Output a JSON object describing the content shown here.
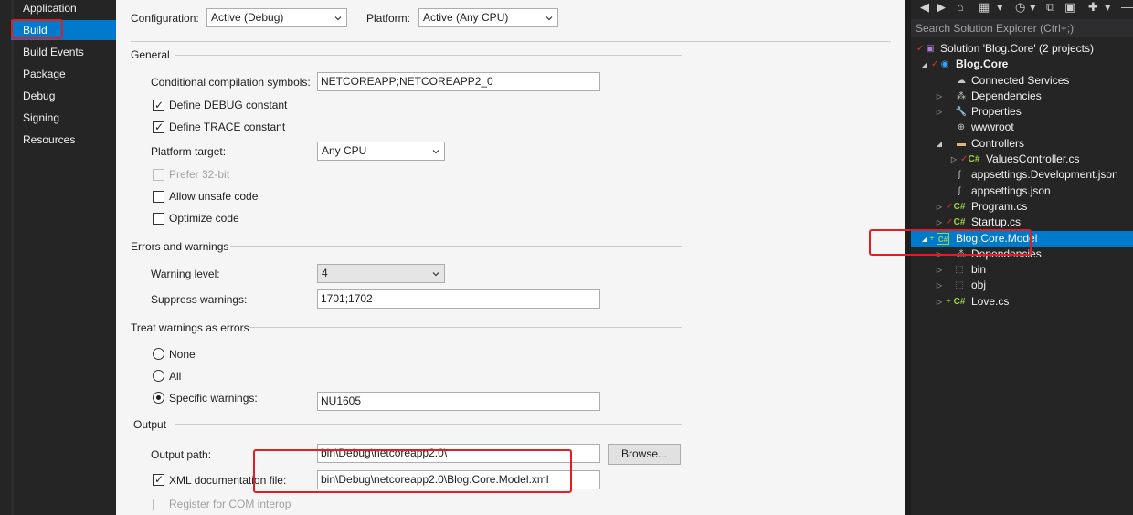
{
  "nav": {
    "items": [
      "Application",
      "Build",
      "Build Events",
      "Package",
      "Debug",
      "Signing",
      "Resources"
    ],
    "active": "Build"
  },
  "header": {
    "configuration_label": "Configuration:",
    "configuration_value": "Active (Debug)",
    "platform_label": "Platform:",
    "platform_value": "Active (Any CPU)"
  },
  "general": {
    "title": "General",
    "cond_symbols_label": "Conditional compilation symbols:",
    "cond_symbols_value": "NETCOREAPP;NETCOREAPP2_0",
    "define_debug": "Define DEBUG constant",
    "define_trace": "Define TRACE constant",
    "platform_target_label": "Platform target:",
    "platform_target_value": "Any CPU",
    "prefer32": "Prefer 32-bit",
    "allow_unsafe": "Allow unsafe code",
    "optimize": "Optimize code"
  },
  "errors": {
    "title": "Errors and warnings",
    "warning_level_label": "Warning level:",
    "warning_level_value": "4",
    "suppress_label": "Suppress warnings:",
    "suppress_value": "1701;1702"
  },
  "treat": {
    "title": "Treat warnings as errors",
    "none": "None",
    "all": "All",
    "specific": "Specific warnings:",
    "specific_value": "NU1605"
  },
  "output": {
    "title": "Output",
    "path_label": "Output path:",
    "path_value": "bin\\Debug\\netcoreapp2.0\\",
    "browse": "Browse...",
    "xml_label": "XML documentation file:",
    "xml_value": "bin\\Debug\\netcoreapp2.0\\Blog.Core.Model.xml",
    "register_com": "Register for COM interop"
  },
  "solution_explorer": {
    "search_placeholder": "Search Solution Explorer (Ctrl+;)",
    "rows": [
      {
        "text": "Solution 'Blog.Core' (2 projects)"
      },
      {
        "text": "Blog.Core"
      },
      {
        "text": "Connected Services"
      },
      {
        "text": "Dependencies"
      },
      {
        "text": "Properties"
      },
      {
        "text": "wwwroot"
      },
      {
        "text": "Controllers"
      },
      {
        "text": "ValuesController.cs"
      },
      {
        "text": "appsettings.Development.json"
      },
      {
        "text": "appsettings.json"
      },
      {
        "text": "Program.cs"
      },
      {
        "text": "Startup.cs"
      },
      {
        "text": "Blog.Core.Model"
      },
      {
        "text": "Dependencies"
      },
      {
        "text": "bin"
      },
      {
        "text": "obj"
      },
      {
        "text": "Love.cs"
      }
    ]
  },
  "colors": {
    "accent": "#007acc",
    "highlight_box": "#e02020",
    "dark_bg": "#252526",
    "page_bg": "#f5f5f5"
  }
}
